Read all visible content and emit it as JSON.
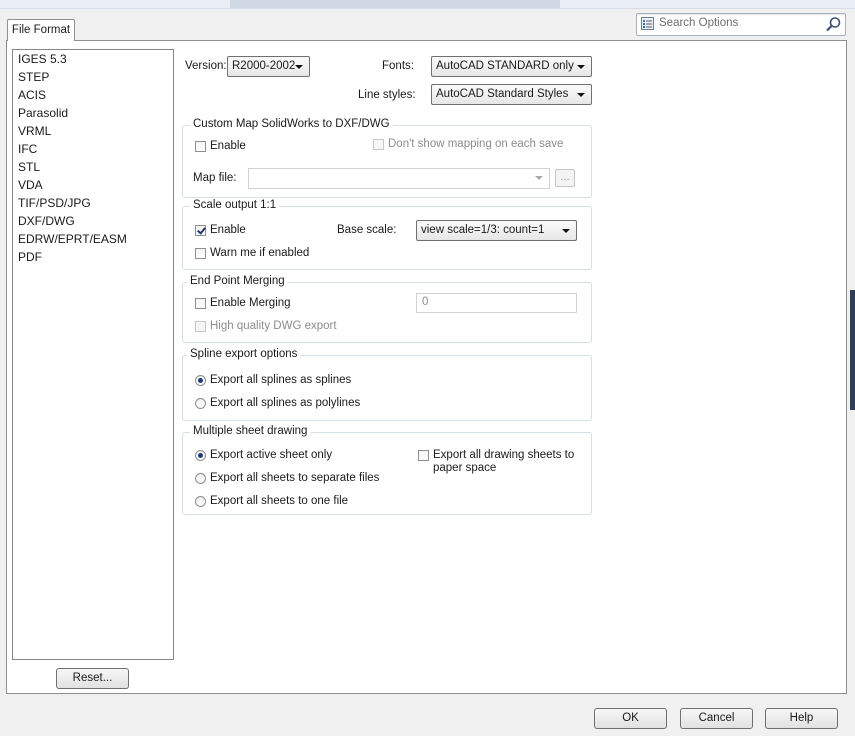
{
  "tab": {
    "label": "File Format"
  },
  "search": {
    "placeholder": "Search Options"
  },
  "formats": [
    "IGES 5.3",
    "STEP",
    "ACIS",
    "Parasolid",
    "VRML",
    "IFC",
    "STL",
    "VDA",
    "TIF/PSD/JPG",
    "DXF/DWG",
    "EDRW/EPRT/EASM",
    "PDF"
  ],
  "selected_format": "DXF/DWG",
  "reset_button": "Reset...",
  "version": {
    "label": "Version:",
    "value": "R2000-2002"
  },
  "fonts": {
    "label": "Fonts:",
    "value": "AutoCAD STANDARD only"
  },
  "line_styles": {
    "label": "Line styles:",
    "value": "AutoCAD Standard Styles"
  },
  "custom_map": {
    "title": "Custom Map SolidWorks to DXF/DWG",
    "enable": "Enable",
    "dont_show": "Don't show mapping on each save",
    "map_file_label": "Map file:",
    "map_file_value": "",
    "browse": "..."
  },
  "scale_output": {
    "title": "Scale output 1:1",
    "enable": "Enable",
    "enable_checked": true,
    "base_scale_label": "Base scale:",
    "base_scale_value": "view scale=1/3: count=1",
    "warn": "Warn me if enabled"
  },
  "end_point": {
    "title": "End Point Merging",
    "enable_merging": "Enable Merging",
    "merge_value": "0",
    "high_quality": "High quality DWG export"
  },
  "spline": {
    "title": "Spline export options",
    "opt1": "Export all splines as splines",
    "opt2": "Export all splines as polylines",
    "selected": 1
  },
  "multi_sheet": {
    "title": "Multiple sheet drawing",
    "opt1": "Export active sheet only",
    "opt2": "Export all sheets to separate files",
    "opt3": "Export all sheets to one file",
    "paper_space_line1": "Export all drawing sheets to",
    "paper_space_line2": "paper space",
    "selected": 1
  },
  "footer": {
    "ok": "OK",
    "cancel": "Cancel",
    "help": "Help"
  }
}
